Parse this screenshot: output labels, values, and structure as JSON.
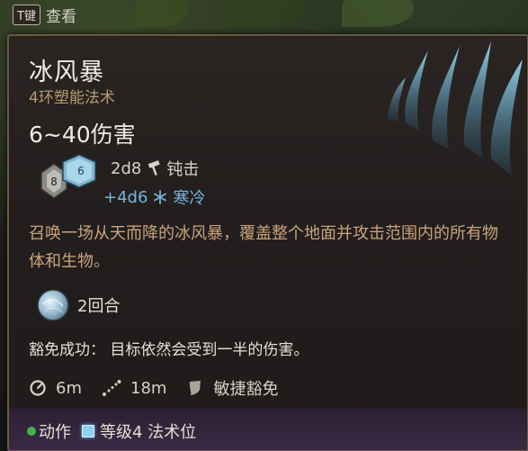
{
  "hint": {
    "key": "T键",
    "label": "查看"
  },
  "spell": {
    "name": "冰风暴",
    "level_school": "4环塑能法术",
    "damage": "6~40伤害",
    "damage_rows": [
      {
        "dice": "2d8",
        "type": "钝击",
        "icon": "hammer-icon",
        "color": "#d9d2c4"
      },
      {
        "dice": "+4d6",
        "type": "寒冷",
        "icon": "snowflake-icon",
        "color": "#76b4d9"
      }
    ],
    "dice_faces": [
      "8",
      "6"
    ],
    "description": "召唤一场从天而降的冰风暴，覆盖整个地面并攻击范围内的所有物体和生物。",
    "duration": "2回合",
    "save": "豁免成功：  目标依然会受到一半的伤害。",
    "stats": [
      {
        "icon": "radius-icon",
        "value": "6m"
      },
      {
        "icon": "range-icon",
        "value": "18m"
      },
      {
        "icon": "shield-icon",
        "value": "敏捷豁免"
      }
    ],
    "cost": {
      "action": "动作",
      "slot": "等级4 法术位"
    }
  },
  "colors": {
    "accent_gold": "#b79a6d",
    "cold_blue": "#76b4d9",
    "action_green": "#45b04e",
    "slot_blue": "#8fd0f2"
  }
}
